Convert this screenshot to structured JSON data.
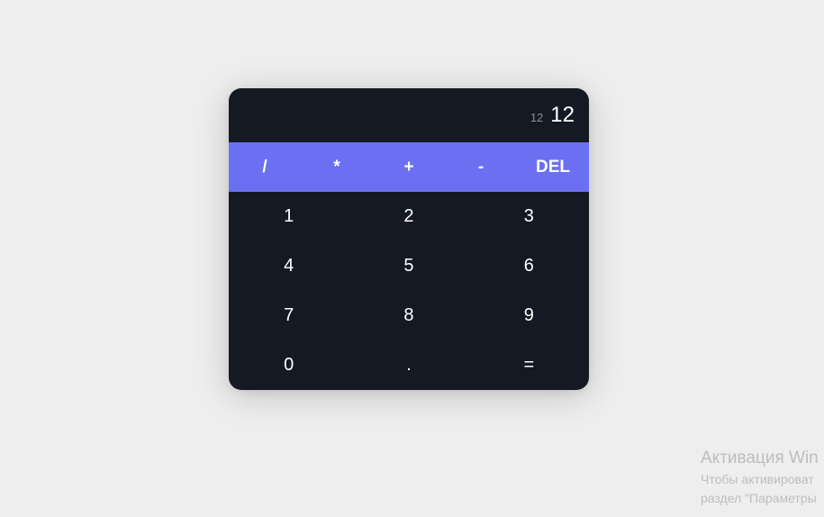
{
  "display": {
    "previous_operand": "12",
    "current_operand": "12"
  },
  "operators": [
    "/",
    "*",
    "+",
    "-",
    "DEL"
  ],
  "digits": [
    "1",
    "2",
    "3",
    "4",
    "5",
    "6",
    "7",
    "8",
    "9",
    "0",
    ".",
    "="
  ],
  "colors": {
    "page_bg": "#eeeeee",
    "calculator_bg": "#141924",
    "operator_bar": "#6b70f3",
    "text": "#ffffff"
  },
  "watermark": {
    "title": "Активация Win",
    "line1": "Чтобы активироват",
    "line2": "раздел \"Параметры"
  }
}
